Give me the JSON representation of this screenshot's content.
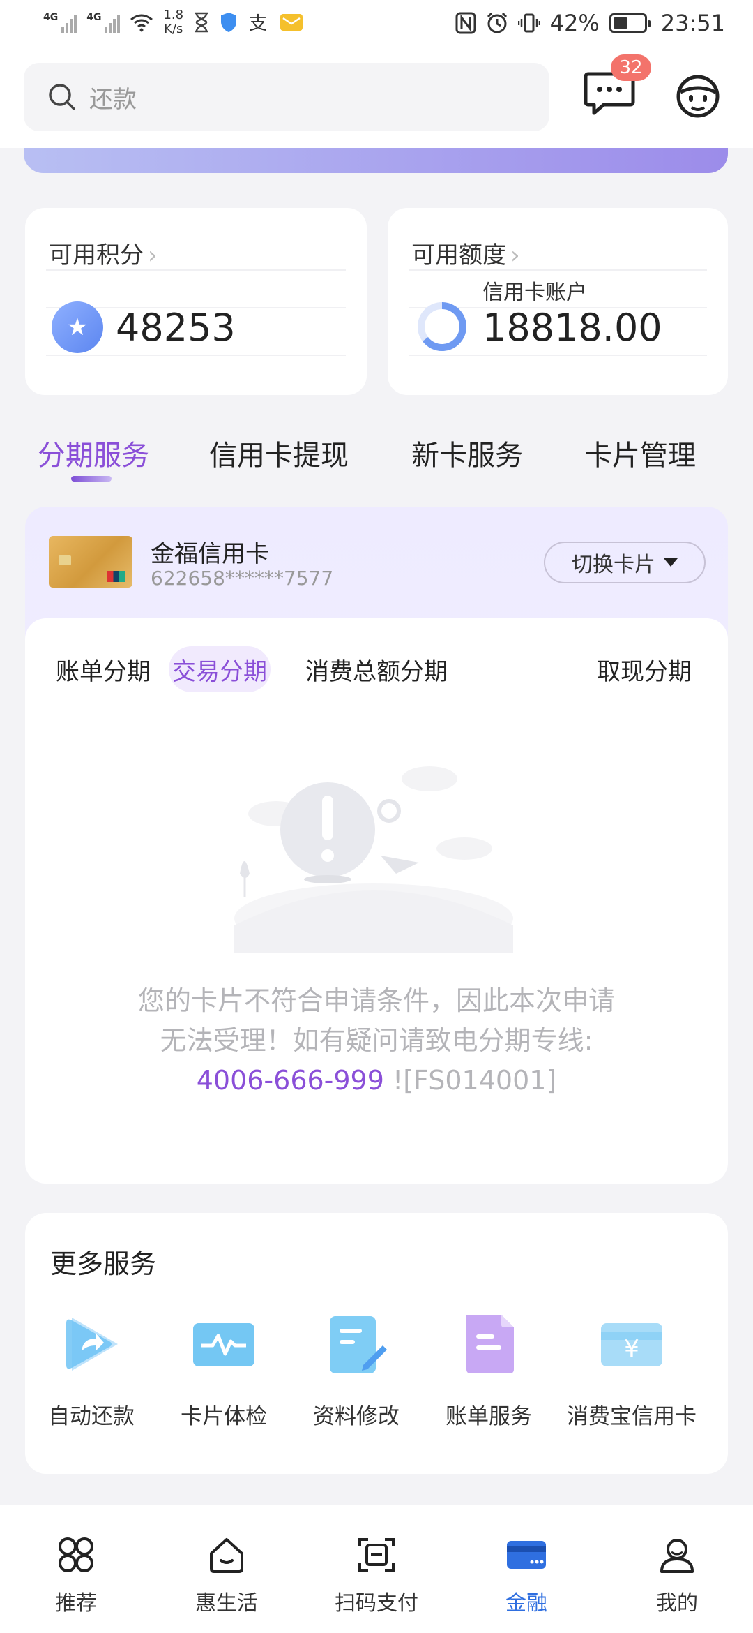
{
  "status_bar": {
    "net1": "4G",
    "net2": "4G",
    "speed": "1.8",
    "speed_unit": "K/s",
    "battery": "42%",
    "time": "23:51"
  },
  "search": {
    "placeholder": "还款"
  },
  "messages": {
    "badge": "32"
  },
  "points_card": {
    "title": "可用积分",
    "value": "48253"
  },
  "credit_card": {
    "title": "可用额度",
    "sub": "信用卡账户",
    "value": "18818.00"
  },
  "main_tabs": [
    "分期服务",
    "信用卡提现",
    "新卡服务",
    "卡片管理"
  ],
  "card": {
    "name": "金福信用卡",
    "number": "622658******7577",
    "switch_label": "切换卡片"
  },
  "sub_tabs": [
    "账单分期",
    "交易分期",
    "消费总额分期",
    "取现分期"
  ],
  "empty": {
    "line1": "您的卡片不符合申请条件，因此本次申请",
    "line2": "无法受理！如有疑问请致电分期专线:",
    "phone": "4006-666-999",
    "code": " ![FS014001]"
  },
  "more_services": {
    "title": "更多服务",
    "items": [
      {
        "label": "自动还款",
        "icon": "auto-repay-icon"
      },
      {
        "label": "卡片体检",
        "icon": "card-checkup-icon"
      },
      {
        "label": "资料修改",
        "icon": "edit-info-icon"
      },
      {
        "label": "账单服务",
        "icon": "bill-service-icon"
      },
      {
        "label": "消费宝信用卡",
        "icon": "yuan-card-icon"
      }
    ]
  },
  "bottom_nav": [
    {
      "label": "推荐",
      "icon": "recommend-icon"
    },
    {
      "label": "惠生活",
      "icon": "home-icon"
    },
    {
      "label": "扫码支付",
      "icon": "scan-icon"
    },
    {
      "label": "金融",
      "icon": "card-icon",
      "active": true
    },
    {
      "label": "我的",
      "icon": "profile-icon"
    }
  ],
  "colors": {
    "accent": "#8a4fd8",
    "nav_active": "#2f6fe0",
    "badge": "#f3736b"
  }
}
